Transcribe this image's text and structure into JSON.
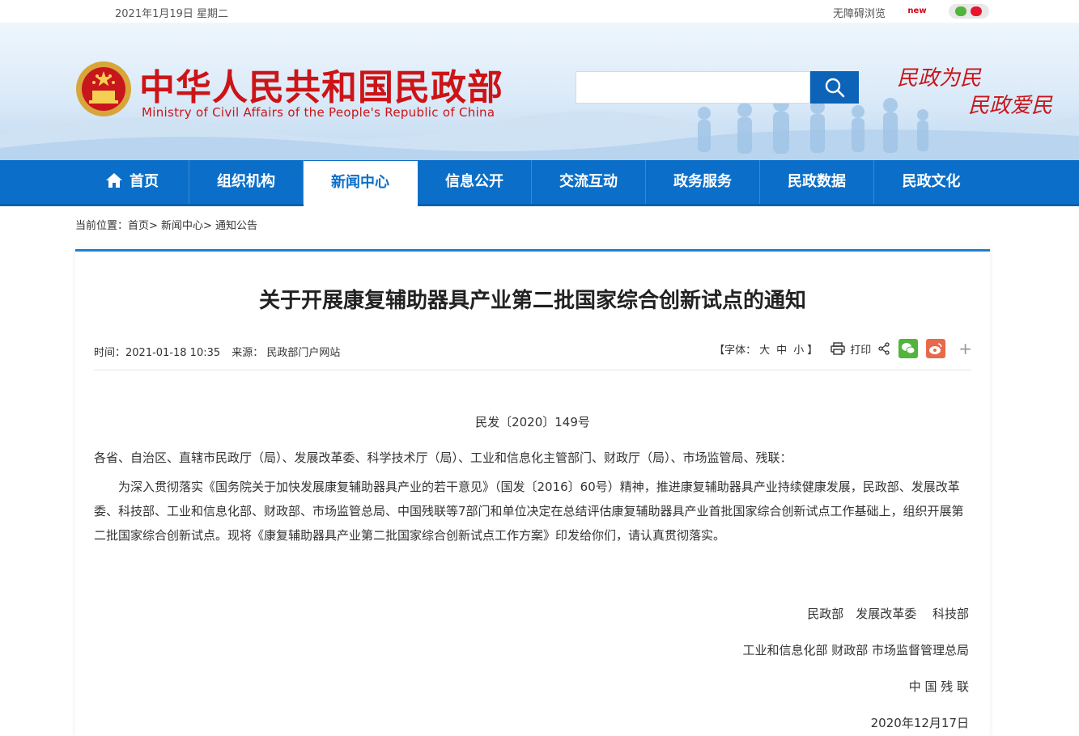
{
  "topbar": {
    "date": "2021年1月19日 星期二",
    "accessibility": "无障碍浏览",
    "new_label": "new"
  },
  "header": {
    "title": "中华人民共和国民政部",
    "subtitle": "Ministry of Civil Affairs of the People's Republic of China",
    "search_placeholder": "",
    "slogan_line1": "民政为民",
    "slogan_line2": "民政爱民",
    "brand_color": "#cc1417"
  },
  "nav": {
    "accent": "#0b6fc9",
    "items": [
      {
        "label": "首页"
      },
      {
        "label": "组织机构"
      },
      {
        "label": "新闻中心"
      },
      {
        "label": "信息公开"
      },
      {
        "label": "交流互动"
      },
      {
        "label": "政务服务"
      },
      {
        "label": "民政数据"
      },
      {
        "label": "民政文化"
      }
    ],
    "active_index": 2
  },
  "breadcrumb": "当前位置：首页> 新闻中心> 通知公告",
  "article": {
    "title": "关于开展康复辅助器具产业第二批国家综合创新试点的通知",
    "time": "时间：2021-01-18 10:35",
    "source": "来源： 民政部门户网站",
    "font_label": "【字体：",
    "font_large": "大",
    "font_medium": "中",
    "font_small": "小",
    "font_close": "】",
    "print_label": "打印",
    "more_label": "+",
    "doc_number": "民发〔2020〕149号",
    "addressee": "各省、自治区、直辖市民政厅（局）、发展改革委、科学技术厅（局）、工业和信息化主管部门、财政厅（局）、市场监管局、残联：",
    "paragraph": "为深入贯彻落实《国务院关于加快发展康复辅助器具产业的若干意见》（国发〔2016〕60号）精神，推进康复辅助器具产业持续健康发展，民政部、发展改革委、科技部、工业和信息化部、财政部、市场监管总局、中国残联等7部门和单位决定在总结评估康复辅助器具产业首批国家综合创新试点工作基础上，组织开展第二批国家综合创新试点。现将《康复辅助器具产业第二批国家综合创新试点工作方案》印发给你们，请认真贯彻落实。",
    "signatures": [
      "民政部　发展改革委　 科技部",
      "工业和信息化部  财政部  市场监督管理总局",
      "中 国 残 联",
      "2020年12月17日"
    ]
  }
}
